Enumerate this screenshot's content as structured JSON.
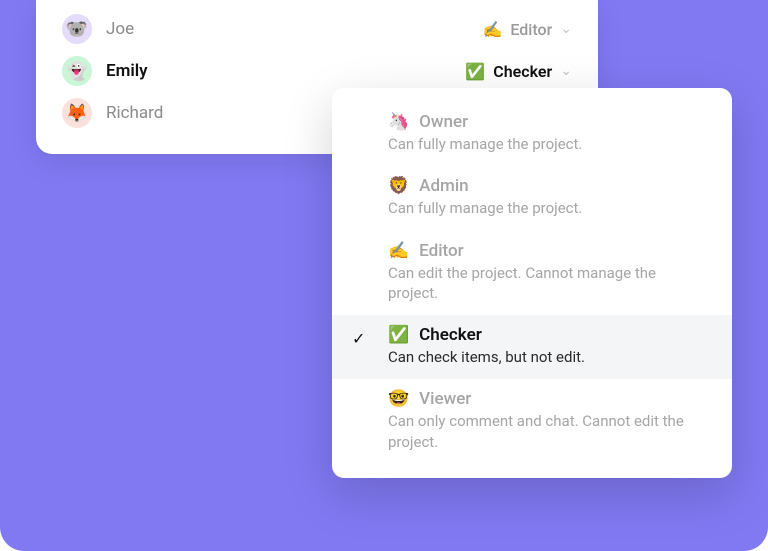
{
  "members": [
    {
      "name": "Joe",
      "avatar_emoji": "🐨",
      "avatar_tone": "purple",
      "role_emoji": "✍️",
      "role_label": "Editor",
      "bold": false
    },
    {
      "name": "Emily",
      "avatar_emoji": "👻",
      "avatar_tone": "green",
      "role_emoji": "✅",
      "role_label": "Checker",
      "bold": true
    },
    {
      "name": "Richard",
      "avatar_emoji": "🦊",
      "avatar_tone": "pink",
      "role_emoji": "",
      "role_label": "",
      "bold": false
    }
  ],
  "roles": [
    {
      "emoji": "🦄",
      "label": "Owner",
      "desc": "Can fully manage the project.",
      "selected": false
    },
    {
      "emoji": "🦁",
      "label": "Admin",
      "desc": "Can fully manage the project.",
      "selected": false
    },
    {
      "emoji": "✍️",
      "label": "Editor",
      "desc": "Can edit the project. Cannot manage the project.",
      "selected": false
    },
    {
      "emoji": "✅",
      "label": "Checker",
      "desc": "Can check items, but not edit.",
      "selected": true
    },
    {
      "emoji": "🤓",
      "label": "Viewer",
      "desc": "Can only comment and chat. Cannot edit the project.",
      "selected": false
    }
  ]
}
